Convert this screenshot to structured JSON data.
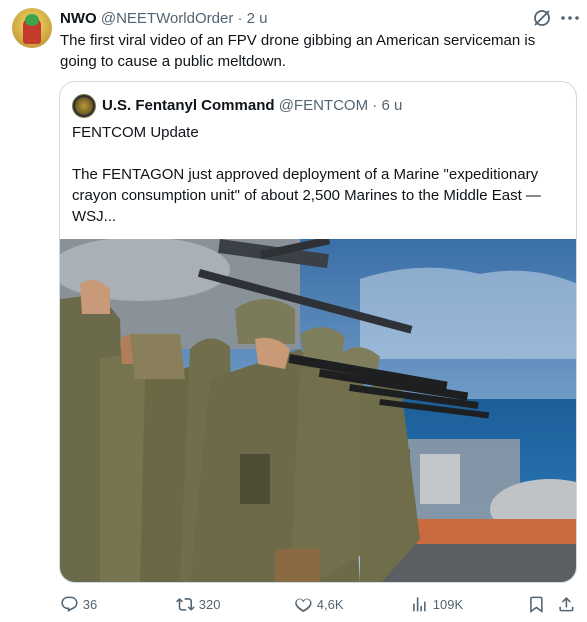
{
  "tweet": {
    "display_name": "NWO",
    "handle": "@NEETWorldOrder",
    "separator": "·",
    "time": "2 u",
    "text": "The first viral video of an FPV drone gibbing an American serviceman is going to cause a public meltdown."
  },
  "quoted": {
    "display_name": "U.S. Fentanyl Command",
    "handle": "@FENTCOM",
    "separator": "·",
    "time": "6 u",
    "text": "FENTCOM Update\n\nThe FENTAGON just approved deployment of a Marine \"expeditionary crayon consumption unit\" of about 2,500 Marines to the Middle East — WSJ..."
  },
  "actions": {
    "replies": "36",
    "reposts": "320",
    "likes": "4,6K",
    "views": "109K"
  },
  "icons": [
    "grok-icon",
    "more-icon",
    "reply-icon",
    "repost-icon",
    "like-icon",
    "views-icon",
    "bookmark-icon",
    "share-icon"
  ],
  "colors": {
    "text": "#0f1419",
    "secondary": "#536471",
    "border": "#cfd9de"
  }
}
